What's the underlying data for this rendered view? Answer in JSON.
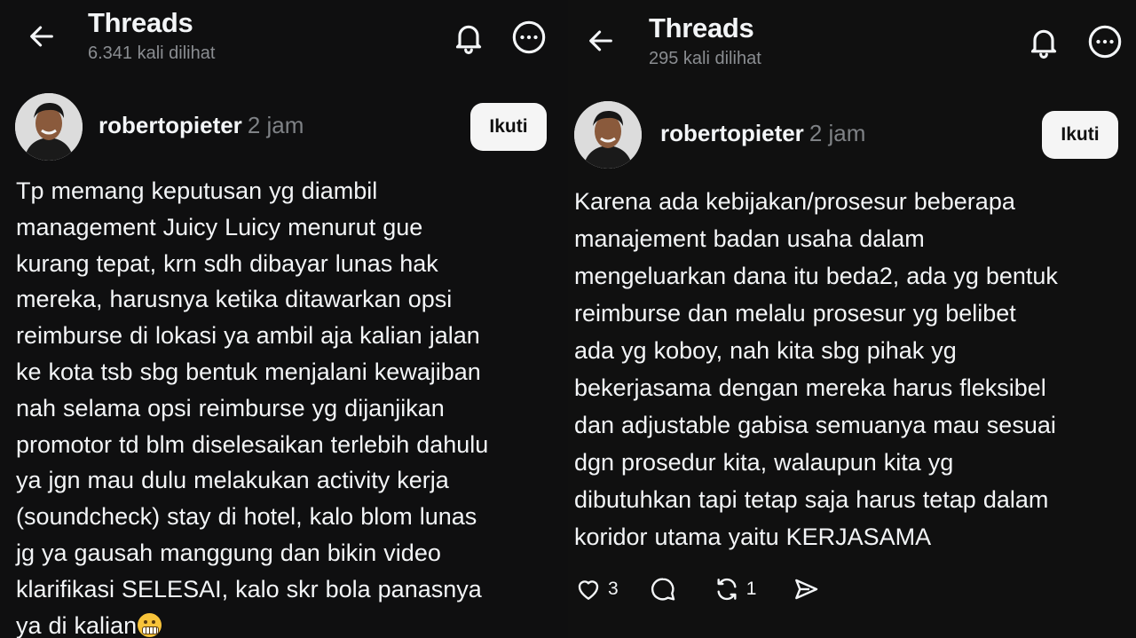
{
  "left": {
    "header": {
      "title": "Threads",
      "views": "6.341 kali dilihat"
    },
    "post": {
      "username": "robertopieter",
      "time": "2 jam",
      "follow_label": "Ikuti",
      "text": "Tp memang keputusan yg diambil\nmanagement Juicy Luicy menurut gue\nkurang tepat, krn sdh dibayar lunas hak\nmereka, harusnya ketika ditawarkan opsi\nreimburse di lokasi ya ambil aja kalian jalan\nke kota tsb sbg bentuk menjalani kewajiban\nnah selama opsi reimburse yg dijanjikan\npromotor td blm diselesaikan terlebih dahulu\nya jgn mau dulu melakukan activity kerja\n(soundcheck) stay di hotel, kalo blom lunas\njg ya gausah manggung dan bikin video\nklarifikasi SELESAI, kalo skr bola panasnya\nya di kalian",
      "emoji": "grimacing-face"
    }
  },
  "right": {
    "header": {
      "title": "Threads",
      "views": "295 kali dilihat"
    },
    "post": {
      "username": "robertopieter",
      "time": "2 jam",
      "follow_label": "Ikuti",
      "text": "Karena ada kebijakan/prosesur beberapa\nmanajement badan usaha dalam\nmengeluarkan dana itu beda2, ada yg bentuk\nreimburse dan melalu prosesur yg belibet\nada yg koboy, nah kita sbg pihak yg\nbekerjasama dengan mereka harus fleksibel\ndan adjustable gabisa semuanya mau sesuai\ndgn prosedur kita, walaupun kita yg\ndibutuhkan tapi tetap saja harus tetap dalam\nkoridor utama yaitu KERJASAMA",
      "actions": {
        "likes": "3",
        "reposts": "1"
      }
    }
  },
  "icons": [
    "back-arrow-icon",
    "bell-icon",
    "more-icon",
    "heart-icon",
    "comment-icon",
    "repost-icon",
    "share-icon"
  ],
  "colors": {
    "background": "#101010",
    "text": "#f3f5f7",
    "muted": "#8a8d91",
    "button_bg": "#f5f5f5"
  }
}
